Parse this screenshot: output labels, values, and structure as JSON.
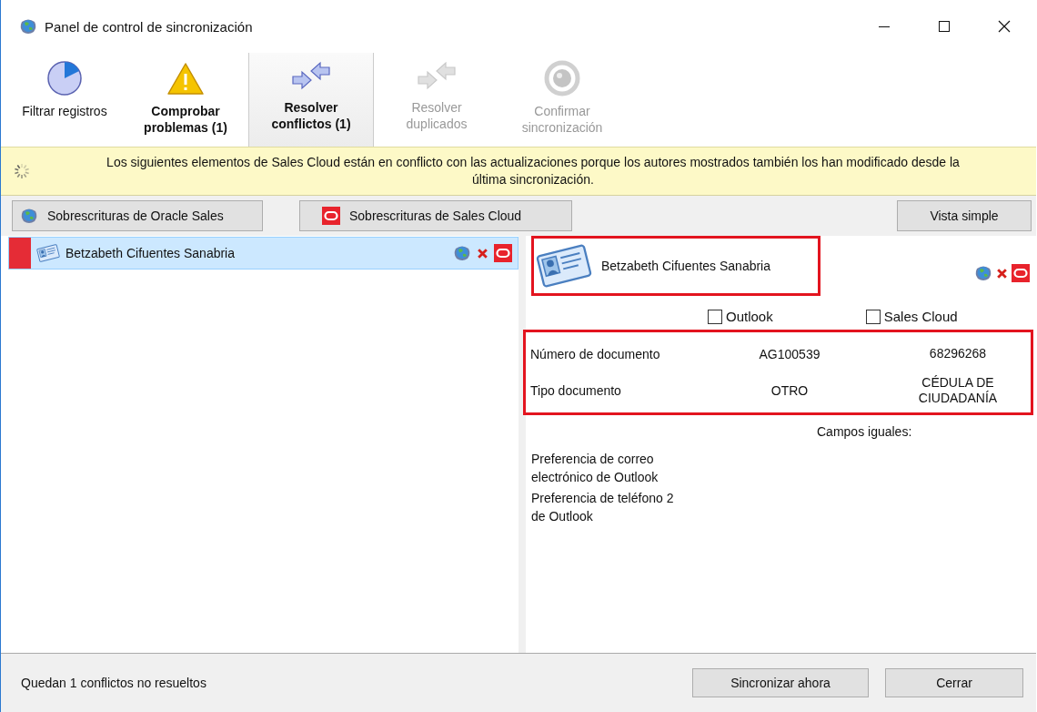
{
  "window": {
    "title": "Panel de control de sincronización"
  },
  "toolbar": [
    {
      "kind": "filter",
      "label": "Filtrar registros",
      "bold": false,
      "selected": false,
      "disabled": false
    },
    {
      "kind": "warning",
      "label": "Comprobar problemas (1)",
      "bold": true,
      "selected": false,
      "disabled": false
    },
    {
      "kind": "resolve",
      "label": "Resolver conflictos (1)",
      "bold": true,
      "selected": true,
      "disabled": false
    },
    {
      "kind": "duplicates",
      "label": "Resolver duplicados",
      "bold": false,
      "selected": false,
      "disabled": true
    },
    {
      "kind": "confirm",
      "label": "Confirmar sincronización",
      "bold": false,
      "selected": false,
      "disabled": true
    }
  ],
  "banner": {
    "message": "Los siguientes elementos de Sales Cloud están en conflicto con las actualizaciones porque los autores mostrados también los han modificado desde la última sincronización."
  },
  "override_buttons": [
    {
      "kind": "globe",
      "label": "Sobrescrituras de Oracle Sales"
    },
    {
      "kind": "oracle",
      "label": "Sobrescrituras de Sales Cloud"
    }
  ],
  "simple_view_button": "Vista simple",
  "conflict_list": [
    {
      "name": "Betzabeth Cifuentes Sanabria",
      "selected": true
    }
  ],
  "detail": {
    "name": "Betzabeth Cifuentes Sanabria",
    "choices": [
      {
        "label": "Outlook",
        "checked": false
      },
      {
        "label": "Sales Cloud",
        "checked": false
      }
    ],
    "conflicts": [
      {
        "field": "Número de documento",
        "outlook": "AG100539",
        "sales_cloud": "68296268"
      },
      {
        "field": "Tipo documento",
        "outlook": "OTRO",
        "sales_cloud": "CÉDULA DE CIUDADANÍA"
      }
    ],
    "equal_heading": "Campos iguales:",
    "equal_fields": [
      "Preferencia de correo electrónico de Outlook",
      "Preferencia de teléfono 2 de Outlook"
    ]
  },
  "status": "Quedan 1 conflictos no resueltos",
  "buttons": [
    "Sincronizar ahora",
    "Cerrar"
  ]
}
